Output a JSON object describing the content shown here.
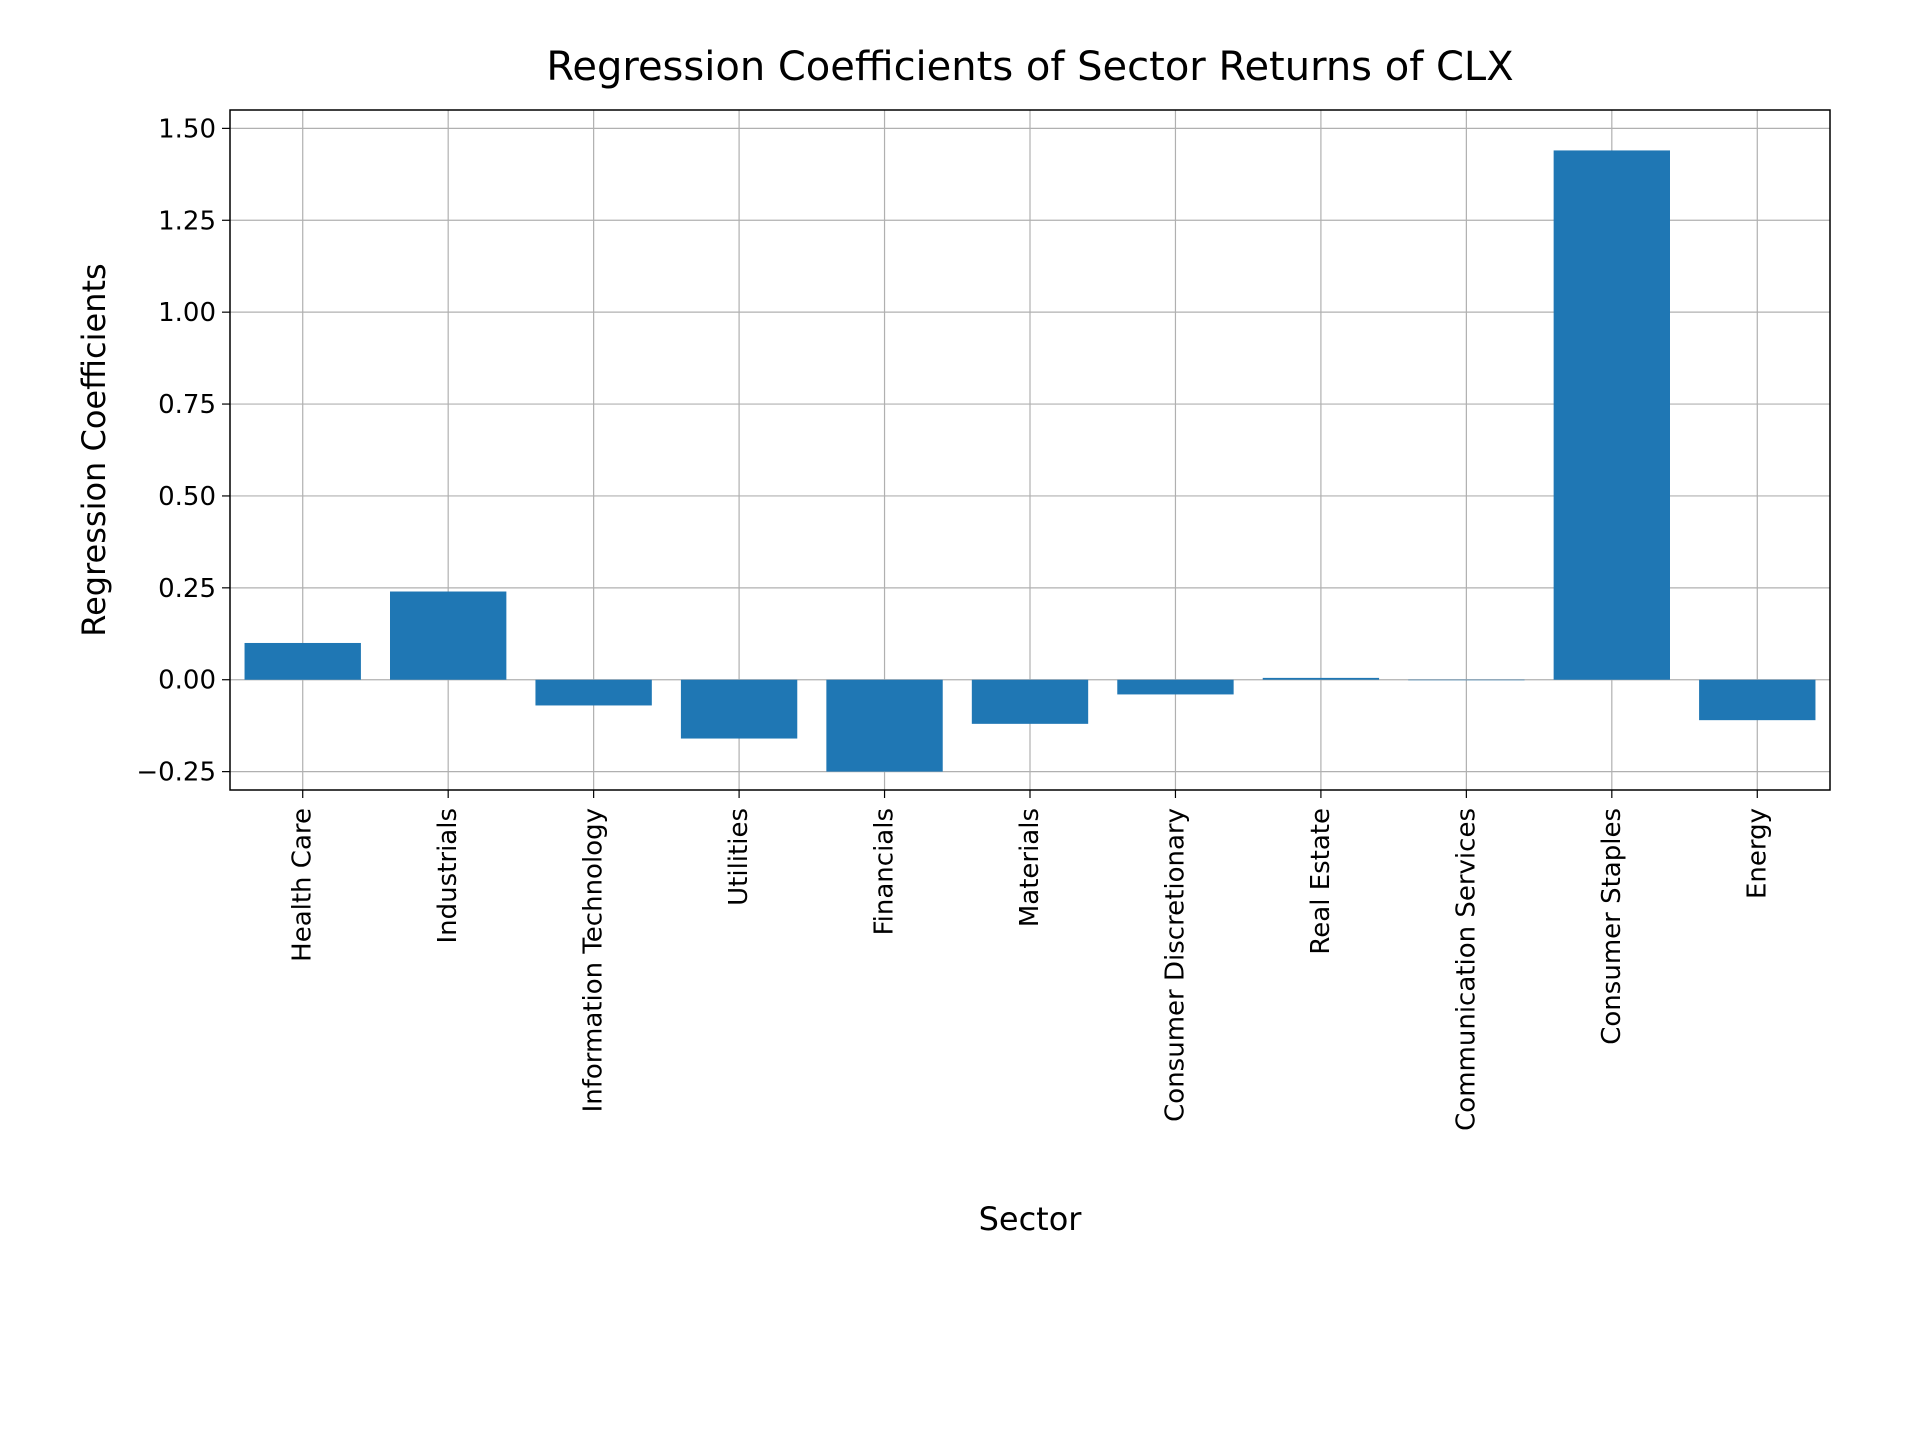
{
  "chart_data": {
    "type": "bar",
    "title": "Regression Coefficients of Sector Returns of CLX",
    "xlabel": "Sector",
    "ylabel": "Regression Coefficients",
    "categories": [
      "Health Care",
      "Industrials",
      "Information Technology",
      "Utilities",
      "Financials",
      "Materials",
      "Consumer Discretionary",
      "Real Estate",
      "Communication Services",
      "Consumer Staples",
      "Energy"
    ],
    "values": [
      0.1,
      0.24,
      -0.07,
      -0.16,
      -0.25,
      -0.12,
      -0.04,
      0.005,
      0.0,
      1.44,
      -0.11
    ],
    "ylim": [
      -0.3,
      1.55
    ],
    "yticks": [
      -0.25,
      0.0,
      0.25,
      0.5,
      0.75,
      1.0,
      1.25,
      1.5
    ],
    "ytick_labels": [
      "−0.25",
      "0.00",
      "0.25",
      "0.50",
      "0.75",
      "1.00",
      "1.25",
      "1.50"
    ],
    "grid": true,
    "bar_color": "#1f77b4"
  }
}
